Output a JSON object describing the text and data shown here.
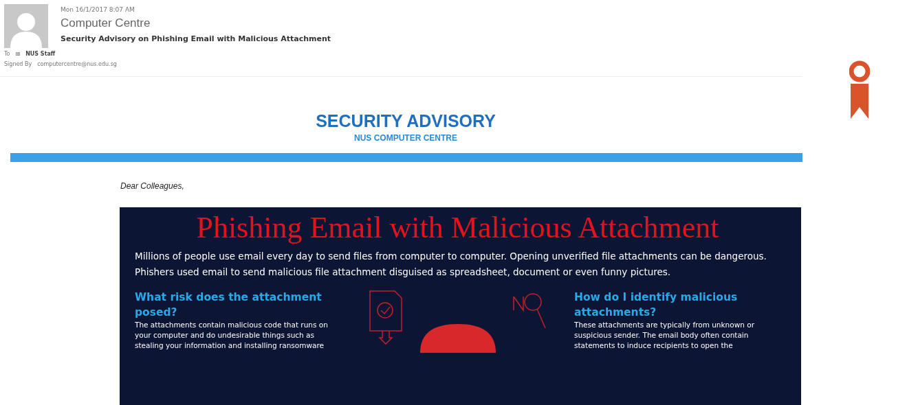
{
  "header": {
    "date": "Mon 16/1/2017 8:07 AM",
    "sender": "Computer Centre",
    "subject": "Security Advisory on Phishing Email with Malicious Attachment",
    "to_label": "To",
    "to_expander": "⊞",
    "to_value": "NUS Staff",
    "signed_label": "Signed By",
    "signed_value": "computercentre@nus.edu.sg"
  },
  "banner": {
    "title": "SECURITY ADVISORY",
    "subtitle": "NUS COMPUTER CENTRE"
  },
  "greeting": "Dear Colleagues,",
  "infographic": {
    "title": "Phishing Email with Malicious Attachment",
    "intro": "Millions of people use email every day to send files from computer to computer. Opening unverified file attachments can be dangerous. Phishers used email to send malicious file attachment disguised as spreadsheet, document or even funny pictures.",
    "sections": [
      {
        "heading": "What risk does the attachment posed?",
        "body": "The attachments contain malicious code that runs on your computer and do undesirable things such as stealing your information and installing ransomware"
      },
      {
        "heading": "How do I identify malicious attachments?",
        "body": "These attachments are typically from unknown or suspicious sender. The email body often contain statements to induce recipients to open the"
      }
    ]
  }
}
